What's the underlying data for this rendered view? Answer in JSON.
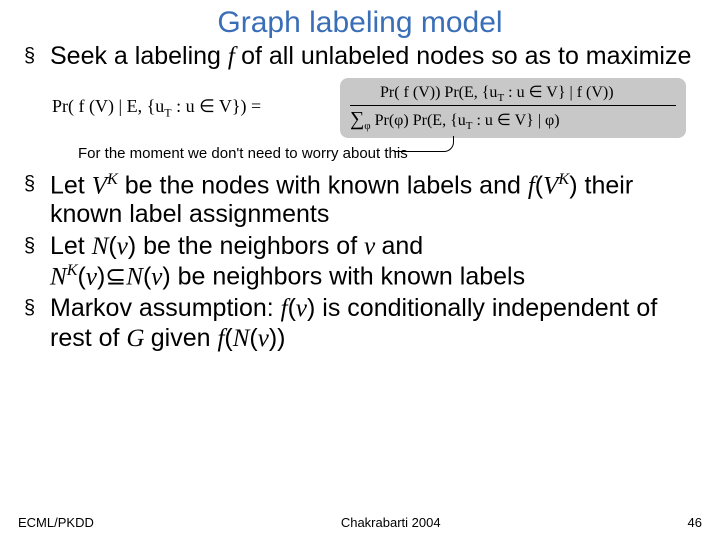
{
  "title": "Graph labeling model",
  "bullet1_a": "Seek a labeling ",
  "bullet1_f": "f ",
  "bullet1_b": "of all unlabeled nodes so as to maximize",
  "lhs": "Pr( f (V) | E, {u",
  "lhs_sub": "T",
  "lhs_tail": " : u ∈ V}) =",
  "num_a": "Pr( f (V)) Pr(E, {u",
  "num_sub": "T",
  "num_b": " : u ∈ V} | f (V))",
  "den_sum": "∑",
  "den_sub": "φ",
  "den_a": " Pr(φ) Pr(E, {u",
  "den_sub2": "T",
  "den_b": " : u ∈ V} | φ)",
  "note": "For the moment we don't need to worry about this",
  "b2_a": "Let  ",
  "b2_vk": "V",
  "b2_vk_sup": "K",
  "b2_b": " be the nodes with known labels and ",
  "b2_fvk1": "f",
  "b2_fvk2": "(",
  "b2_fvk3": "V",
  "b2_fvk_sup": "K",
  "b2_fvk4": ")",
  "b2_c": " their known label assignments",
  "b3_a": "Let ",
  "b3_nv": "N",
  "b3_nv2": "(",
  "b3_v": "v",
  "b3_nv3": ")",
  "b3_b": " be the neighbors of ",
  "b3_v2": "v ",
  "b3_c": "and ",
  "b3_nk1": "N",
  "b3_nk_sup": "K",
  "b3_nk2": "(",
  "b3_nk_v": "v",
  "b3_nk3": ")",
  "b3_subset": "⊆",
  "b3_nv_again1": "N",
  "b3_nv_again2": "(",
  "b3_nv_again_v": "v",
  "b3_nv_again3": ")",
  "b3_d": " be neighbors with known labels",
  "b4_a": "Markov assumption: ",
  "b4_fv1": "f",
  "b4_fv2": "(",
  "b4_fv_v": "v",
  "b4_fv3": ")",
  "b4_b": " is conditionally independent of rest of ",
  "b4_g": "G ",
  "b4_c": "given ",
  "b4_fn1": "f",
  "b4_fn2": "(",
  "b4_fn_n": "N",
  "b4_fn3": "(",
  "b4_fn_v": "v",
  "b4_fn4": "))",
  "footer_left": "ECML/PKDD",
  "footer_center": "Chakrabarti 2004",
  "footer_right": "46"
}
